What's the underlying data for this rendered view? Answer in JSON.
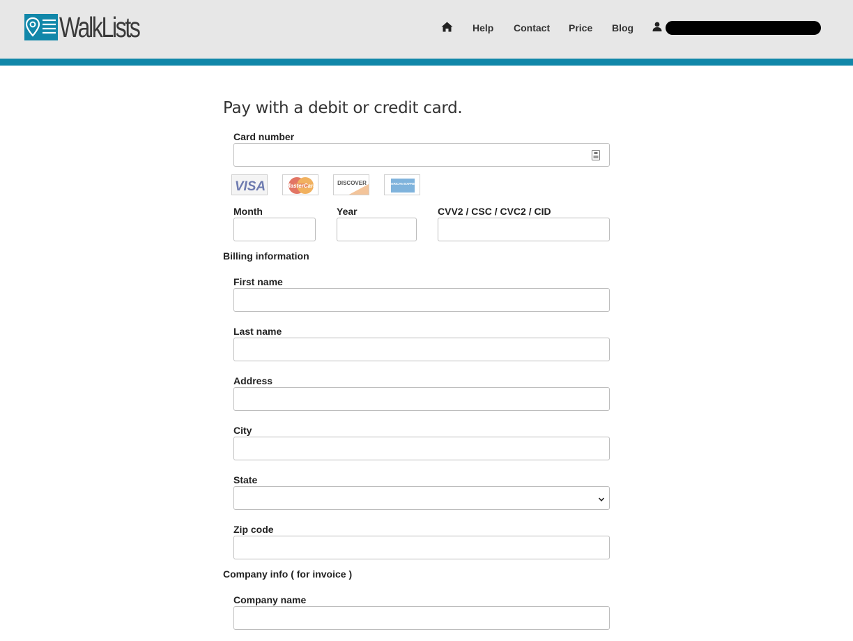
{
  "brand": {
    "name": "WalkLists",
    "accent": "#1187a9"
  },
  "nav": {
    "home_icon": "home-icon",
    "links": [
      "Help",
      "Contact",
      "Price",
      "Blog"
    ],
    "user_icon": "user-icon"
  },
  "form": {
    "title": "Pay with a debit or credit card.",
    "card_number_label": "Card number",
    "card_brands": [
      "VISA",
      "MasterCard",
      "DISCOVER",
      "AMERICAN EXPRESS"
    ],
    "month_label": "Month",
    "year_label": "Year",
    "cvv_label": "CVV2 / CSC / CVC2 / CID",
    "billing_section": "Billing information",
    "first_name_label": "First name",
    "last_name_label": "Last name",
    "address_label": "Address",
    "city_label": "City",
    "state_label": "State",
    "state_value": "",
    "zip_label": "Zip code",
    "company_section": "Company info ( for invoice )",
    "company_name_label": "Company name"
  }
}
